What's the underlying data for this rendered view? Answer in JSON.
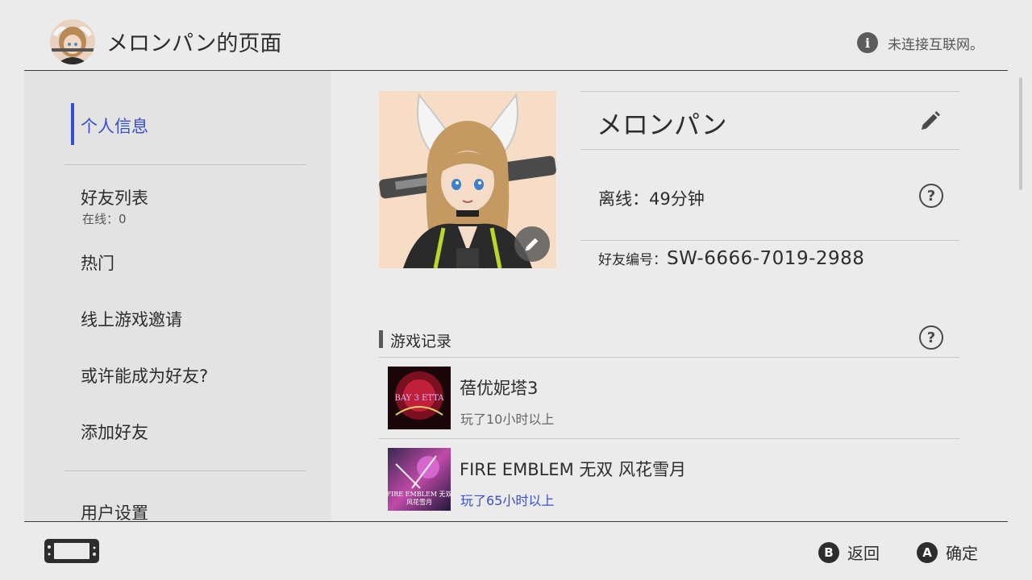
{
  "header": {
    "title": "メロンパン的页面",
    "network_status": "未连接互联网。",
    "info_icon": "i"
  },
  "sidebar": {
    "items": [
      {
        "label": "个人信息",
        "selected": true
      },
      {
        "label": "好友列表",
        "sub": "在线：0"
      },
      {
        "label": "热门"
      },
      {
        "label": "线上游戏邀请"
      },
      {
        "label": "或许能成为好友?"
      },
      {
        "label": "添加好友"
      },
      {
        "label": "用户设置"
      }
    ]
  },
  "profile": {
    "nickname": "メロンパン",
    "status": "离线：49分钟",
    "friend_code_label": "好友编号：",
    "friend_code": "SW-6666-7019-2988"
  },
  "play_history": {
    "title": "游戏记录",
    "games": [
      {
        "title": "蓓优妮塔3",
        "play_time": "玩了10小时以上",
        "thumb_logo": "BAY 3 ETTA"
      },
      {
        "title": "FIRE EMBLEM 无双 风花雪月",
        "play_time": "玩了65小时以上",
        "thumb_logo": "FIRE EMBLEM 无双",
        "thumb_logo_sub": "风花雪月"
      }
    ]
  },
  "footer": {
    "back_key": "B",
    "back_label": "返回",
    "confirm_key": "A",
    "confirm_label": "确定"
  },
  "colors": {
    "accent": "#3a4ed0",
    "background": "#ebebeb",
    "sidebar_background": "#e3e3e3",
    "text": "#2d2d2d"
  },
  "help_icon_glyph": "?"
}
